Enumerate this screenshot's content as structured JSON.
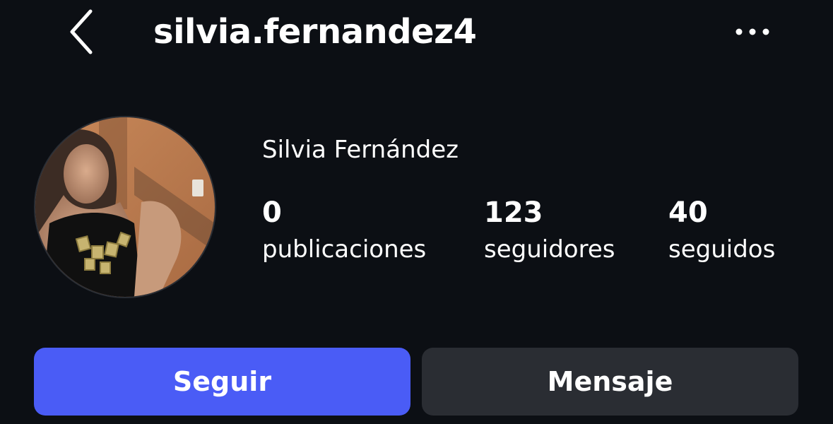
{
  "header": {
    "username": "silvia.fernandez4",
    "back_icon": "chevron-left-icon",
    "more_icon": "more-horizontal-icon"
  },
  "profile": {
    "display_name": "Silvia Fernández",
    "avatar": "profile-photo",
    "stats": {
      "posts": {
        "count": "0",
        "label": "publicaciones"
      },
      "followers": {
        "count": "123",
        "label": "seguidores"
      },
      "following": {
        "count": "40",
        "label": "seguidos"
      }
    }
  },
  "actions": {
    "follow_label": "Seguir",
    "message_label": "Mensaje"
  },
  "colors": {
    "background": "#0c0f14",
    "follow_button": "#4a5cf6",
    "message_button": "#2a2d33",
    "text": "#ffffff"
  }
}
